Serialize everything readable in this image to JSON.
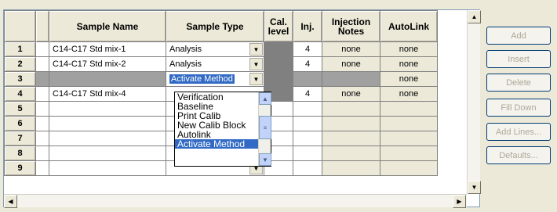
{
  "columns": {
    "sample_name": "Sample Name",
    "sample_type": "Sample Type",
    "cal_level": "Cal. level",
    "inj": "Inj.",
    "injection_notes": "Injection Notes",
    "autolink": "AutoLink"
  },
  "rows": [
    {
      "num": "1",
      "name": "C14-C17 Std mix-1",
      "type": "Analysis",
      "inj": "4",
      "notes": "none",
      "autolink": "none"
    },
    {
      "num": "2",
      "name": "C14-C17 Std mix-2",
      "type": "Analysis",
      "inj": "4",
      "notes": "none",
      "autolink": "none"
    },
    {
      "num": "3",
      "name": "",
      "type": "Activate Method",
      "inj": "",
      "notes": "",
      "autolink": "none"
    },
    {
      "num": "4",
      "name": "C14-C17 Std mix-4",
      "type": "",
      "inj": "4",
      "notes": "none",
      "autolink": "none"
    },
    {
      "num": "5",
      "name": "",
      "type": "",
      "inj": "",
      "notes": "",
      "autolink": ""
    },
    {
      "num": "6",
      "name": "",
      "type": "",
      "inj": "",
      "notes": "",
      "autolink": ""
    },
    {
      "num": "7",
      "name": "",
      "type": "",
      "inj": "",
      "notes": "",
      "autolink": ""
    },
    {
      "num": "8",
      "name": "",
      "type": "",
      "inj": "",
      "notes": "",
      "autolink": ""
    },
    {
      "num": "9",
      "name": "",
      "type": "",
      "inj": "",
      "notes": "",
      "autolink": ""
    }
  ],
  "dropdown_options": [
    "Verification",
    "Baseline",
    "Print Calib",
    "New Calib Block",
    "Autolink",
    "Activate Method"
  ],
  "dropdown_selected": "Activate Method",
  "side_buttons": {
    "add": "Add",
    "insert": "Insert",
    "delete": "Delete",
    "fill_down": "Fill Down",
    "add_lines": "Add Lines...",
    "defaults": "Defaults..."
  },
  "colors": {
    "selection": "#316ac5",
    "disabled_cell": "#808080",
    "window_bg": "#ece9d8"
  }
}
